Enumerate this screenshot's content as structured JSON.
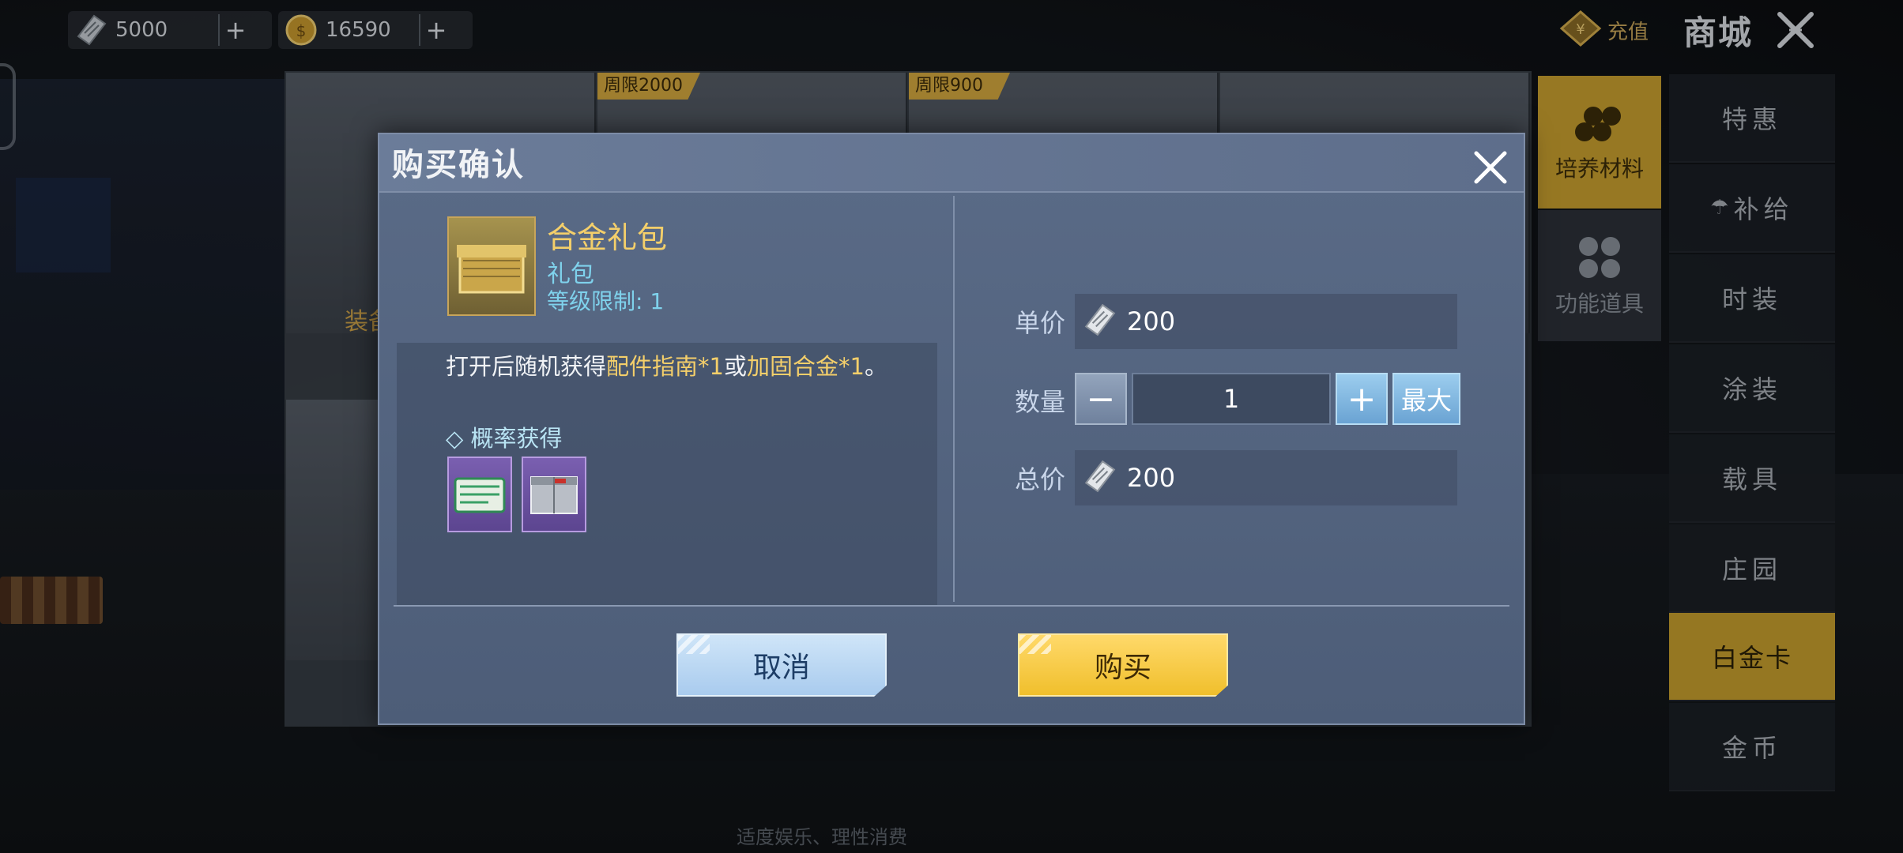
{
  "currency": {
    "silver": {
      "icon": "silver-ticket-icon",
      "value": "5000"
    },
    "gold": {
      "icon": "gold-coin-icon",
      "value": "16590"
    },
    "plus": "+"
  },
  "header": {
    "recharge_label": "充值",
    "shop_title": "商城"
  },
  "shop_cards": {
    "tag1": "周限2000",
    "tag2": "周限900",
    "partial_label": "装备"
  },
  "category_tabs": [
    {
      "label": "培养材料",
      "icon": "wood-logs-icon",
      "active": true
    },
    {
      "label": "功能道具",
      "icon": "four-leaf-icon",
      "active": false
    }
  ],
  "nav": [
    {
      "label": "特惠",
      "active": false
    },
    {
      "label": "补给",
      "active": false,
      "icon": "parachute-icon"
    },
    {
      "label": "时装",
      "active": false
    },
    {
      "label": "涂装",
      "active": false
    },
    {
      "label": "载具",
      "active": false
    },
    {
      "label": "庄园",
      "active": false
    },
    {
      "label": "白金卡",
      "active": true
    },
    {
      "label": "金币",
      "active": false
    }
  ],
  "notice": "适度娱乐、理性消费",
  "dialog": {
    "title": "购买确认",
    "item": {
      "name": "合金礼包",
      "type": "礼包",
      "level": "等级限制: 1"
    },
    "description": {
      "prefix": "打开后随机获得",
      "item1": "配件指南*1",
      "mid": "或",
      "item2": "加固合金*1",
      "suffix": "。"
    },
    "probability_label": "◇ 概率获得",
    "rewards": [
      {
        "icon": "accessory-guide-book-icon"
      },
      {
        "icon": "reinforced-alloy-icon"
      }
    ],
    "unit_price_label": "单价",
    "unit_price": "200",
    "quantity_label": "数量",
    "quantity": "1",
    "minus": "−",
    "plus": "+",
    "max_label": "最大",
    "total_label": "总价",
    "total_price": "200",
    "cancel_label": "取消",
    "buy_label": "购买"
  },
  "colors": {
    "accent_gold": "#f0bf2c",
    "dialog_bg": "#546581",
    "highlight_text": "#f4cf6a",
    "info_text": "#7fd2ec"
  }
}
